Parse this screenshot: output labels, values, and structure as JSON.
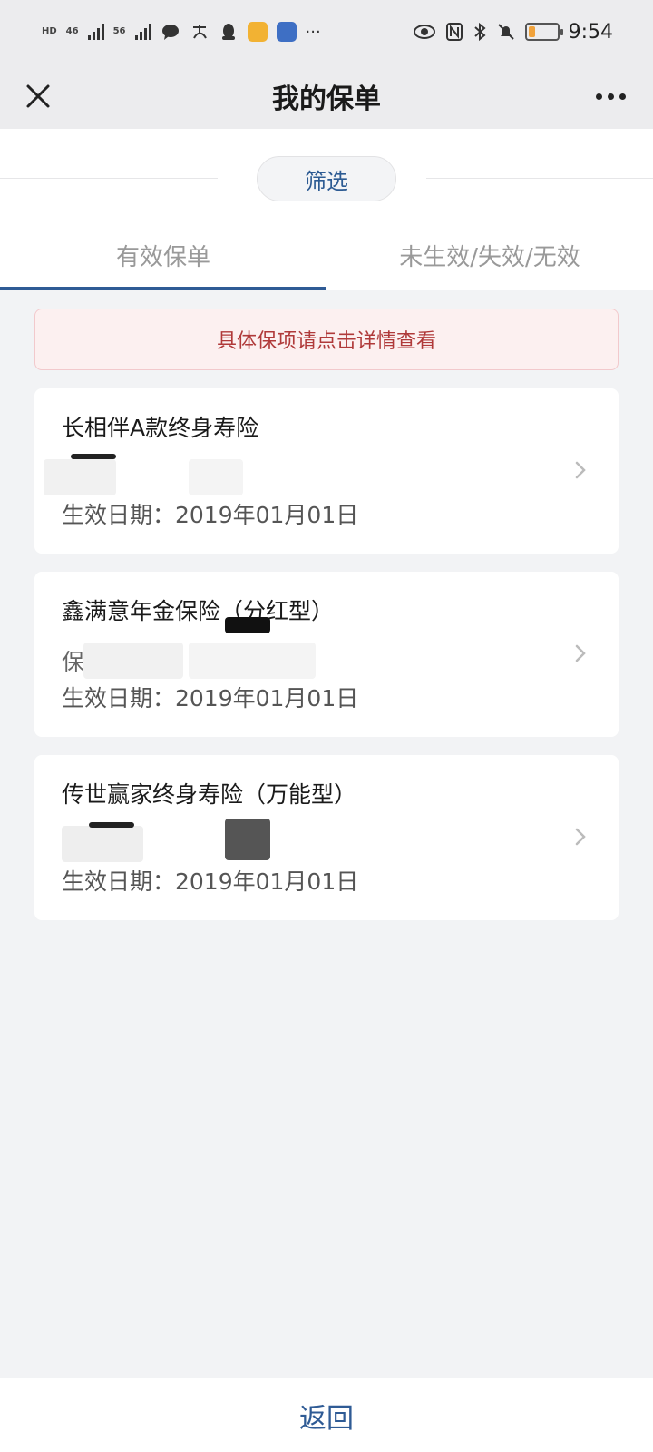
{
  "status_bar": {
    "left_labels": [
      "HD",
      "46",
      "56"
    ],
    "time": "9:54",
    "icons": [
      "signal-icon",
      "chat-icon",
      "alipay-icon",
      "qq-icon",
      "mail-icon",
      "app-icon",
      "more-dots-icon",
      "eye-icon",
      "nfc-icon",
      "bluetooth-icon",
      "bell-mute-icon",
      "battery-icon"
    ],
    "battery_level": 0.25,
    "battery_color": "#f0a23b"
  },
  "header": {
    "title": "我的保单"
  },
  "filter": {
    "label": "筛选"
  },
  "tabs": [
    {
      "label": "有效保单",
      "active": true
    },
    {
      "label": "未生效/失效/无效",
      "active": false
    }
  ],
  "notice": {
    "text": "具体保项请点击详情查看"
  },
  "policies": [
    {
      "name": "长相伴A款终身寿险",
      "masked_prefix": "",
      "date": "生效日期：2019年01月01日"
    },
    {
      "name": "鑫满意年金保险（分红型）",
      "masked_prefix": "保",
      "date": "生效日期：2019年01月01日"
    },
    {
      "name": "传世赢家终身寿险（万能型）",
      "masked_prefix": "",
      "date": "生效日期：2019年01月01日"
    }
  ],
  "footer": {
    "back_label": "返回"
  },
  "colors": {
    "accent": "#2f5b95",
    "notice_text": "#b03a3a",
    "notice_bg": "#fcf0f0"
  }
}
